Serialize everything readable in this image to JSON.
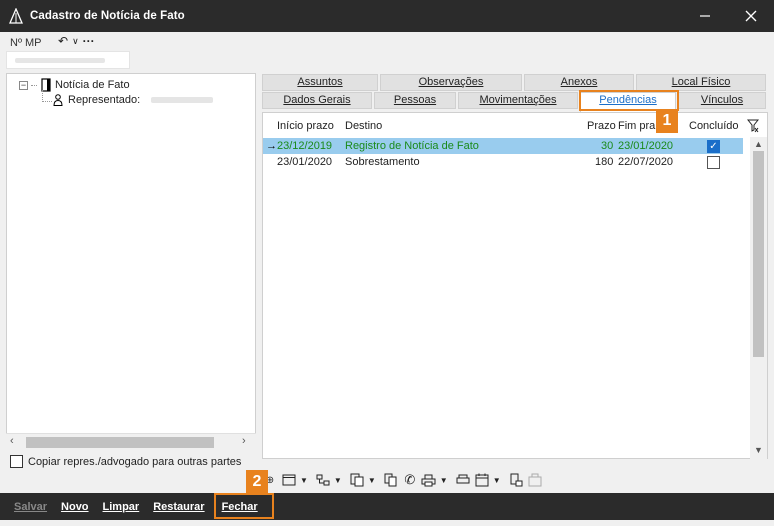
{
  "window": {
    "title": "Cadastro de Notícia de Fato"
  },
  "header": {
    "mp_label": "Nº MP"
  },
  "tree": {
    "root_label": "Notícia de Fato",
    "child_label": "Representado:"
  },
  "copy_option": {
    "label": "Copiar repres./advogado para outras partes"
  },
  "tabs": {
    "row1": [
      "Assuntos",
      "Observações",
      "Anexos",
      "Local Físico"
    ],
    "row2": [
      "Dados Gerais",
      "Pessoas",
      "Movimentações",
      "Pendências",
      "Vínculos"
    ],
    "active": "Pendências"
  },
  "grid": {
    "columns": {
      "inicio": "Início prazo",
      "destino": "Destino",
      "prazo": "Prazo",
      "fim": "Fim pra",
      "concluido": "Concluído"
    },
    "rows": [
      {
        "inicio": "23/12/2019",
        "destino": "Registro de Notícia de Fato",
        "prazo": "30",
        "fim": "23/01/2020",
        "concluido": true
      },
      {
        "inicio": "23/01/2020",
        "destino": "Sobrestamento",
        "prazo": "180",
        "fim": "22/07/2020",
        "concluido": false
      }
    ]
  },
  "footer": {
    "salvar": "Salvar",
    "novo": "Novo",
    "limpar": "Limpar",
    "restaurar": "Restaurar",
    "fechar": "Fechar"
  },
  "callouts": {
    "one": "1",
    "two": "2"
  },
  "colors": {
    "accent": "#e8821e",
    "titlebar": "#2b2b2b",
    "selected_row": "#99ccee",
    "selected_text": "#1a8a1a",
    "active_tab": "#1a6ec9"
  }
}
